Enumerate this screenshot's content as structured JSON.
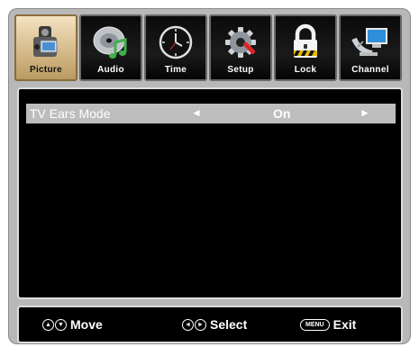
{
  "tabs": [
    {
      "label": "Picture",
      "icon": "camera-icon",
      "active": true
    },
    {
      "label": "Audio",
      "icon": "music-disc-icon",
      "active": false
    },
    {
      "label": "Time",
      "icon": "clock-icon",
      "active": false
    },
    {
      "label": "Setup",
      "icon": "gear-wrench-icon",
      "active": false
    },
    {
      "label": "Lock",
      "icon": "padlock-icon",
      "active": false
    },
    {
      "label": "Channel",
      "icon": "satellite-monitor-icon",
      "active": false
    }
  ],
  "setting": {
    "name": "TV Ears Mode",
    "left_arrow": "◄",
    "value": "On",
    "right_arrow": "►"
  },
  "footer": {
    "move_label": "Move",
    "select_label": "Select",
    "menu_key": "MENU",
    "exit_label": "Exit"
  }
}
